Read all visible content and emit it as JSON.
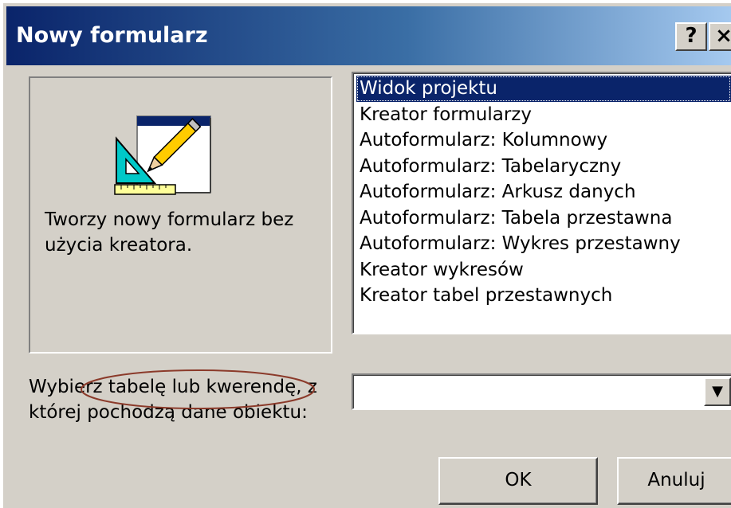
{
  "window": {
    "title": "Nowy formularz",
    "help_label": "?",
    "close_label": "×"
  },
  "preview": {
    "icon": "form-design-icon",
    "description": "Tworzy nowy formularz bez użycia kreatora."
  },
  "form_types": {
    "selected_index": 0,
    "items": [
      "Widok projektu",
      "Kreator formularzy",
      "Autoformularz:  Kolumnowy",
      "Autoformularz:  Tabelaryczny",
      "Autoformularz:  Arkusz danych",
      "Autoformularz: Tabela przestawna",
      "Autoformularz: Wykres przestawny",
      "Kreator wykresów",
      "Kreator tabel przestawnych"
    ]
  },
  "source": {
    "label": "Wybierz tabelę lub kwerendę, z której pochodzą dane obiektu:",
    "value": "",
    "dropdown_icon": "dropdown-arrow-icon"
  },
  "buttons": {
    "ok_label": "OK",
    "cancel_label": "Anuluj"
  },
  "colors": {
    "face": "#d4d0c8",
    "title_start": "#0a246a",
    "title_end": "#a6caf0",
    "selection": "#0a246a",
    "annotation": "#8b3a2a"
  }
}
